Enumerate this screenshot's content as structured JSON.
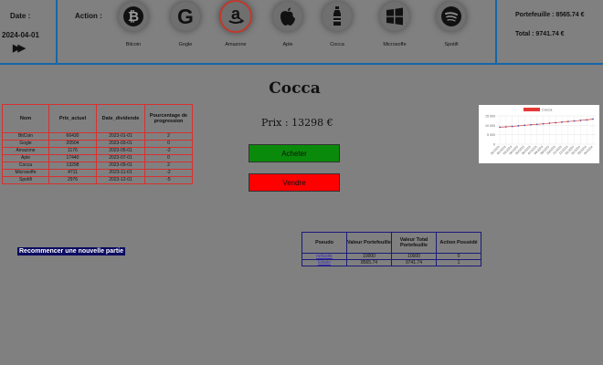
{
  "header": {
    "date_label": "Date :",
    "date_value": "2024-04-01",
    "next_glyph": "▶▶",
    "action_label": "Action :",
    "portfolio": "Portefeuille : 8565.74 €",
    "total": "Total : 9741.74 €"
  },
  "companies": [
    {
      "name": "Bitcoin",
      "icon": "bitcoin-icon"
    },
    {
      "name": "Gogle",
      "icon": "google-icon"
    },
    {
      "name": "Amazone",
      "icon": "amazon-icon"
    },
    {
      "name": "Aple",
      "icon": "apple-icon"
    },
    {
      "name": "Cocca",
      "icon": "bottle-icon"
    },
    {
      "name": "Microsoffe",
      "icon": "windows-icon"
    },
    {
      "name": "Spotifi",
      "icon": "spotify-icon"
    }
  ],
  "selected": {
    "title": "Cocca",
    "price": "Prix : 13298 €",
    "buy_label": "Acheter",
    "sell_label": "Vendre"
  },
  "stocks_table": {
    "headers": [
      "Nom",
      "Prix_actuel",
      "Date_dividende",
      "Pourcentage de progression"
    ],
    "rows": [
      [
        "BitCoin",
        "66430",
        "2023-01-01",
        "2"
      ],
      [
        "Gogle",
        "20504",
        "2023-03-01",
        "0"
      ],
      [
        "Amazone",
        "1176",
        "2023-05-01",
        "-2"
      ],
      [
        "Aple",
        "17440",
        "2023-07-01",
        "0"
      ],
      [
        "Cocca",
        "13298",
        "2023-09-01",
        "2"
      ],
      [
        "Microsoffe",
        "4711",
        "2023-11-01",
        "-2"
      ],
      [
        "Spotifi",
        "2976",
        "2023-12-01",
        "-5"
      ]
    ]
  },
  "restart_label": "Recommencer une nouvelle partie",
  "players_table": {
    "headers": [
      "Pseudo",
      "Valeur Portefeuille",
      "Valeur Total Portefeuille",
      "Action Possédé"
    ],
    "rows": [
      [
        "nefaoite",
        "10000",
        "10000",
        "0"
      ],
      [
        "Eibalo",
        "8565.74",
        "9741.74",
        "1"
      ]
    ]
  },
  "chart_data": {
    "type": "line",
    "legend": "Cocca",
    "legend_position": "top",
    "color": "#e53935",
    "ylim": [
      0,
      15000
    ],
    "yticks": [
      "15 000",
      "10 000",
      "5 000",
      "0"
    ],
    "x": [
      "01/2023",
      "02/2023",
      "03/2023",
      "04/2023",
      "05/2023",
      "06/2023",
      "07/2023",
      "08/2023",
      "09/2023",
      "10/2023",
      "11/2023",
      "12/2023",
      "01/2024",
      "02/2024",
      "03/2024",
      "04/2024"
    ],
    "values": [
      9000,
      9200,
      9400,
      9700,
      10000,
      10300,
      10500,
      10800,
      11100,
      11400,
      11700,
      12000,
      12300,
      12600,
      12900,
      13298
    ]
  }
}
